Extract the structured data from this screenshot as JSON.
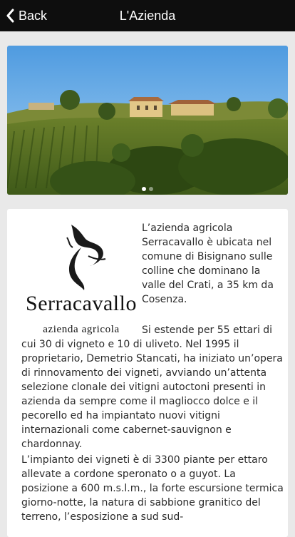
{
  "navbar": {
    "back_label": "Back",
    "back_icon": "chevron-left-icon",
    "title": "L'Azienda"
  },
  "gallery": {
    "page_count": 2,
    "active_index": 0
  },
  "content": {
    "logo": {
      "name": "Serracavallo",
      "subtitle": "azienda agricola"
    },
    "paragraph_1": "L’azienda agricola Serracavallo è ubicata nel comune di Bisignano sulle colline che dominano la valle del Crati, a 35 km da Cosenza.",
    "paragraph_2a": "Si estende per 55 ettari di",
    "paragraph_2b": "cui 30 di vigneto e 10 di uliveto. Nel 1995 il proprietario, Demetrio Stancati, ha iniziato un’opera di rinnovamento dei vigneti, avviando un’attenta selezione clonale dei vitigni autoctoni presenti in azienda da sempre come il magliocco dolce e il pecorello ed ha impiantato nuovi vitigni internazionali come cabernet-sauvignon e chardonnay.",
    "paragraph_3": "L’impianto dei vigneti è di 3300 piante per ettaro allevate a cordone speronato o a guyot. La posizione a 600 m.s.l.m., la forte escursione termica giorno-notte, la natura di sabbione granitico del terreno, l’esposizione a sud sud-"
  },
  "colors": {
    "navbar_bg": "#0e0e0e",
    "page_bg": "#e9e9e9",
    "card_bg": "#ffffff",
    "text": "#2b2b2b"
  }
}
